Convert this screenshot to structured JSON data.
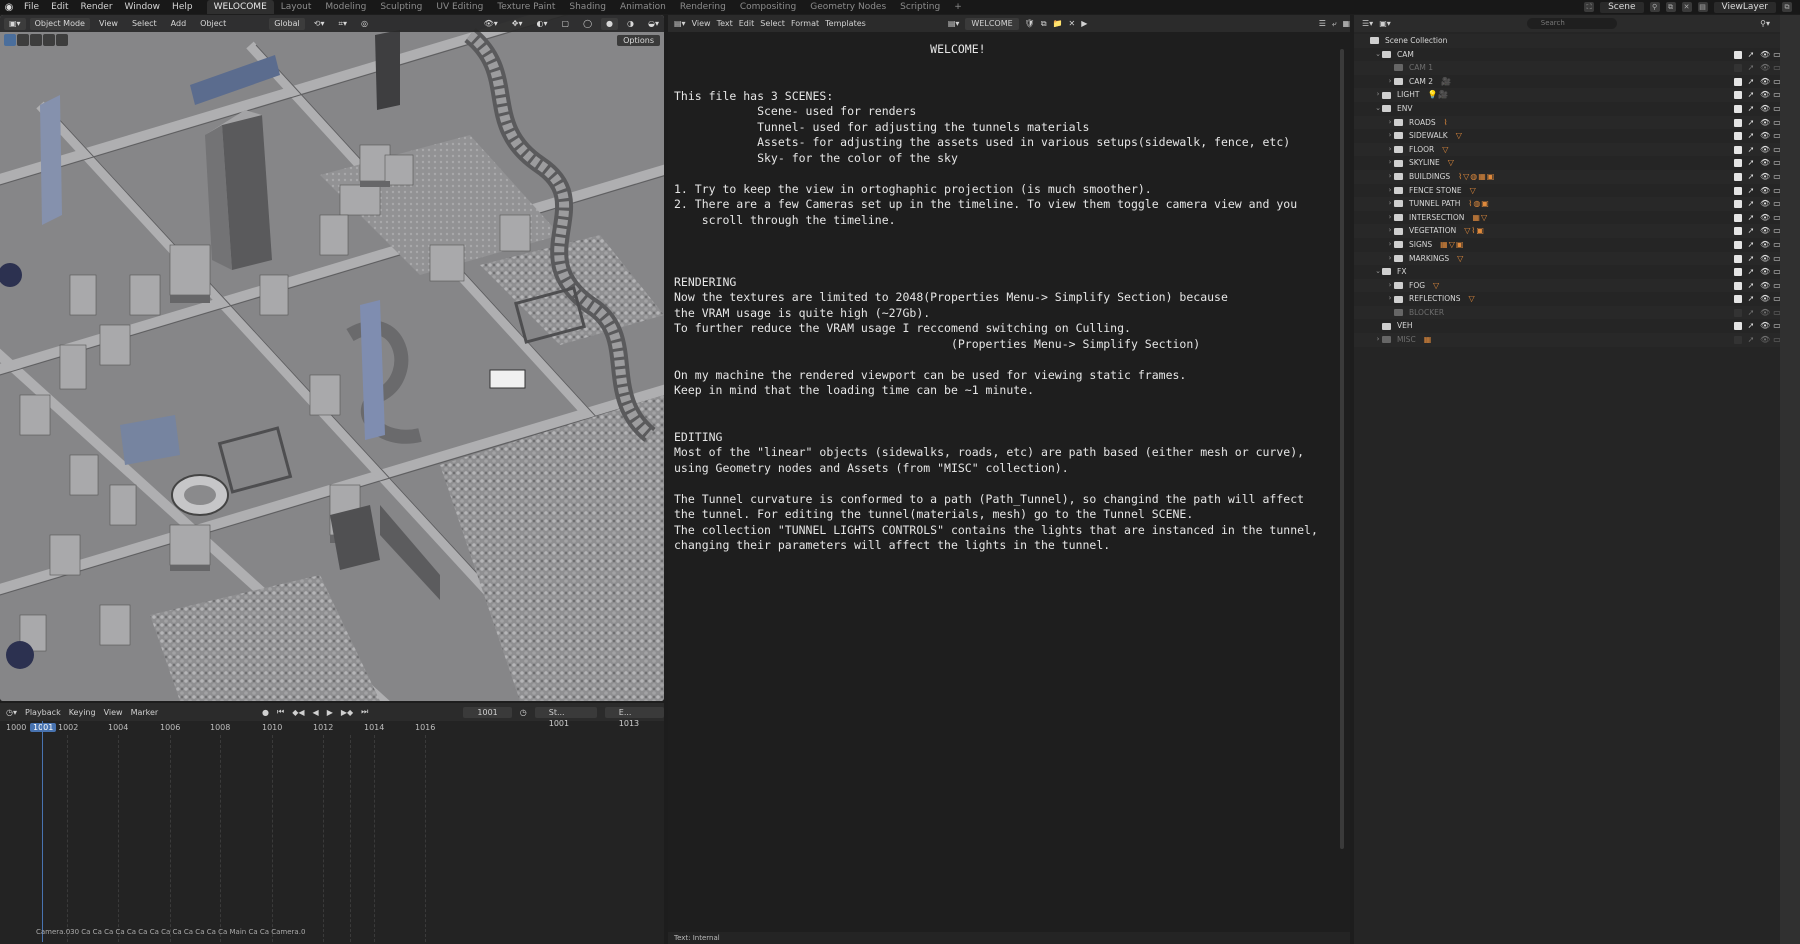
{
  "topbar": {
    "menus": [
      "File",
      "Edit",
      "Render",
      "Window",
      "Help"
    ],
    "workspaces": [
      "WELOCOME",
      "Layout",
      "Modeling",
      "Sculpting",
      "UV Editing",
      "Texture Paint",
      "Shading",
      "Animation",
      "Rendering",
      "Compositing",
      "Geometry Nodes",
      "Scripting"
    ],
    "active_workspace": "WELOCOME",
    "add_tab": "+",
    "scene": "Scene",
    "view_layer": "ViewLayer"
  },
  "viewport": {
    "mode": "Object Mode",
    "menus": [
      "View",
      "Select",
      "Add",
      "Object"
    ],
    "orientation": "Global",
    "options": "Options"
  },
  "timeline": {
    "menus": [
      "Playback",
      "Keying",
      "View",
      "Marker"
    ],
    "current_frame": "1001",
    "start_label": "St...",
    "start": "1001",
    "end_label": "E...",
    "end": "1013",
    "ruler": [
      "1000",
      "1001",
      "1002",
      "1004",
      "1006",
      "1008",
      "1010",
      "1012",
      "1014",
      "1016"
    ],
    "markers_text": "Camera.030  Ca  Ca  Ca  Ca  Ca  Ca  Ca  Ca  Ca  Ca  Ca  Ca  Ca  Main  Ca  Ca  Camera.0"
  },
  "text_editor": {
    "menus": [
      "View",
      "Text",
      "Edit",
      "Select",
      "Format",
      "Templates"
    ],
    "file_name": "WELCOME",
    "footer": "Text: Internal",
    "content": "                                     WELCOME!\n\n\nThis file has 3 SCENES:\n            Scene- used for renders\n            Tunnel- used for adjusting the tunnels materials\n            Assets- for adjusting the assets used in various setups(sidewalk, fence, etc)\n            Sky- for the color of the sky\n\n1. Try to keep the view in ortoghaphic projection (is much smoother).\n2. There are a few Cameras set up in the timeline. To view them toggle camera view and you\n    scroll through the timeline.\n\n\n\nRENDERING\nNow the textures are limited to 2048(Properties Menu-> Simplify Section) because\nthe VRAM usage is quite high (~27Gb).\nTo further reduce the VRAM usage I reccomend switching on Culling.\n                                        (Properties Menu-> Simplify Section)\n\nOn my machine the rendered viewport can be used for viewing static frames.\nKeep in mind that the loading time can be ~1 minute.\n\n\nEDITING\nMost of the \"linear\" objects (sidewalks, roads, etc) are path based (either mesh or curve),\nusing Geometry nodes and Assets (from \"MISC\" collection).\n\nThe Tunnel curvature is conformed to a path (Path_Tunnel), so changind the path will affect\nthe tunnel. For editing the tunnel(materials, mesh) go to the Tunnel SCENE.\nThe collection \"TUNNEL LIGHTS CONTROLS\" contains the lights that are instanced in the tunnel,\nchanging their parameters will affect the lights in the tunnel."
  },
  "outliner": {
    "search_placeholder": "Search",
    "rows": [
      {
        "label": "Scene Collection",
        "indent": 0,
        "arrow": "",
        "tags": "",
        "dim": false,
        "check": false
      },
      {
        "label": "CAM",
        "indent": 1,
        "arrow": "v",
        "tags": "",
        "dim": false,
        "check": true
      },
      {
        "label": "CAM 1",
        "indent": 2,
        "arrow": "",
        "tags": "",
        "dim": true,
        "check": false
      },
      {
        "label": "CAM 2",
        "indent": 2,
        "arrow": ">",
        "tags": "🎥",
        "dim": false,
        "check": true
      },
      {
        "label": "LIGHT",
        "indent": 1,
        "arrow": ">",
        "tags": "💡🎥",
        "dim": false,
        "check": true
      },
      {
        "label": "ENV",
        "indent": 1,
        "arrow": "v",
        "tags": "",
        "dim": false,
        "check": true
      },
      {
        "label": "ROADS",
        "indent": 2,
        "arrow": ">",
        "tags": "⌇",
        "dim": false,
        "check": true
      },
      {
        "label": "SIDEWALK",
        "indent": 2,
        "arrow": ">",
        "tags": "▽",
        "dim": false,
        "check": true
      },
      {
        "label": "FLOOR",
        "indent": 2,
        "arrow": ">",
        "tags": "▽",
        "dim": false,
        "check": true
      },
      {
        "label": "SKYLINE",
        "indent": 2,
        "arrow": ">",
        "tags": "▽",
        "dim": false,
        "check": true
      },
      {
        "label": "BUILDINGS",
        "indent": 2,
        "arrow": ">",
        "tags": "⌇▽◍▦▣",
        "dim": false,
        "check": true
      },
      {
        "label": "FENCE STONE",
        "indent": 2,
        "arrow": ">",
        "tags": "▽",
        "dim": false,
        "check": true
      },
      {
        "label": "TUNNEL PATH",
        "indent": 2,
        "arrow": ">",
        "tags": "⌇◍▣",
        "dim": false,
        "check": true
      },
      {
        "label": "INTERSECTION",
        "indent": 2,
        "arrow": ">",
        "tags": "▦▽",
        "dim": false,
        "check": true
      },
      {
        "label": "VEGETATION",
        "indent": 2,
        "arrow": ">",
        "tags": "▽⌇▣",
        "dim": false,
        "check": true
      },
      {
        "label": "SIGNS",
        "indent": 2,
        "arrow": ">",
        "tags": "▦▽▣",
        "dim": false,
        "check": true
      },
      {
        "label": "MARKINGS",
        "indent": 2,
        "arrow": ">",
        "tags": "▽",
        "dim": false,
        "check": true
      },
      {
        "label": "FX",
        "indent": 1,
        "arrow": "v",
        "tags": "",
        "dim": false,
        "check": true
      },
      {
        "label": "FOG",
        "indent": 2,
        "arrow": ">",
        "tags": "▽",
        "dim": false,
        "check": true
      },
      {
        "label": "REFLECTIONS",
        "indent": 2,
        "arrow": ">",
        "tags": "▽",
        "dim": false,
        "check": true
      },
      {
        "label": "BLOCKER",
        "indent": 2,
        "arrow": "",
        "tags": "",
        "dim": true,
        "check": false
      },
      {
        "label": "VEH",
        "indent": 1,
        "arrow": "",
        "tags": "",
        "dim": false,
        "check": true
      },
      {
        "label": "MISC",
        "indent": 1,
        "arrow": ">",
        "tags": "▦",
        "dim": true,
        "check": false
      }
    ]
  },
  "colors": {
    "accent": "#4873b0",
    "tag_orange": "#e08a3c",
    "viewport_bg": "#7f7f81"
  }
}
